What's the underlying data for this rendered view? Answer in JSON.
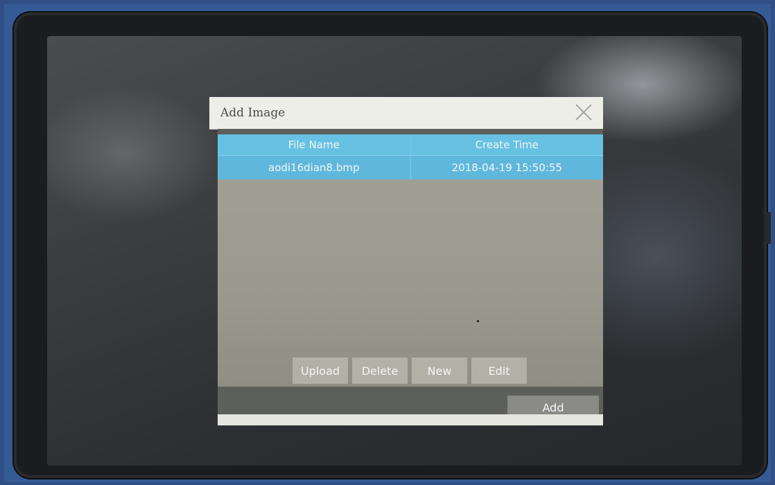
{
  "dialog": {
    "title": "Add Image",
    "close_icon": "close-icon"
  },
  "table": {
    "columns": [
      "File Name",
      "Create Time"
    ],
    "rows": [
      {
        "file_name": "aodi16dian8.bmp",
        "create_time": "2018-04-19 15:50:55"
      }
    ]
  },
  "buttons": {
    "upload": "Upload",
    "delete": "Delete",
    "new": "New",
    "edit": "Edit",
    "add": "Add"
  },
  "colors": {
    "header_blue": "#66c1e3",
    "selected_row_blue": "#5fb8dc",
    "button_gray": "#b2b1a6",
    "device_blue": "#355b97"
  }
}
